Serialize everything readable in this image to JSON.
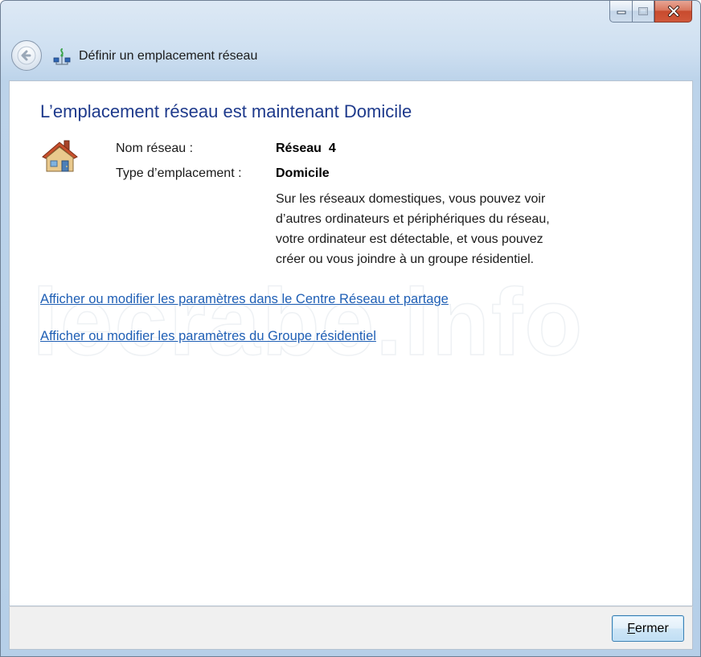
{
  "window": {
    "title": "Définir un emplacement réseau",
    "caption_buttons": {
      "minimize_icon": "minimize-icon",
      "maximize_icon": "maximize-icon",
      "close_icon": "close-icon"
    },
    "back_icon": "back-arrow-icon"
  },
  "content": {
    "headline": "L’emplacement réseau est maintenant Domicile",
    "icon": "home-network-icon",
    "network_name_label": "Nom réseau :",
    "network_name_value": "Réseau  4",
    "location_type_label": "Type d’emplacement :",
    "location_type_value": "Domicile",
    "description_lines": [
      "Sur les réseaux domestiques, vous pouvez voir",
      "d’autres ordinateurs et périphériques du réseau,",
      "votre ordinateur est détectable, et vous pouvez",
      "créer ou vous joindre à un groupe résidentiel."
    ],
    "links": [
      "Afficher ou modifier les paramètres dans le Centre Réseau et partage",
      "Afficher ou modifier les paramètres du Groupe résidentiel"
    ],
    "watermark": "lecrabe.info"
  },
  "footer": {
    "close_button_accel": "F",
    "close_button_rest": "ermer"
  },
  "colors": {
    "headline": "#1e3a8c",
    "link": "#1f5fb5",
    "frame": "#bcd3ea"
  }
}
